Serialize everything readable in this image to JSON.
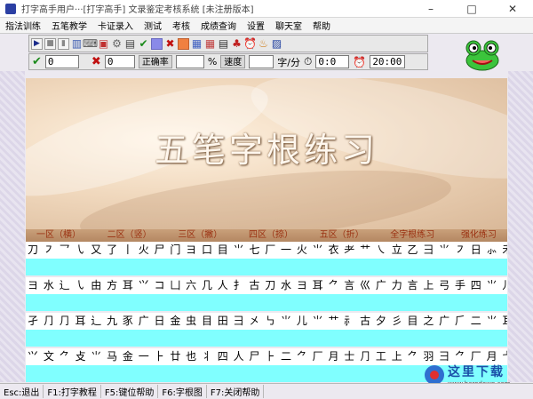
{
  "window": {
    "title": "打字高手用户···[打字高手]      文录鉴定考核系统  [未注册版本]",
    "minimize_glyph": "–",
    "maximize_glyph": "□",
    "close_glyph": "✕"
  },
  "menu": [
    "指法训练",
    "五笔教学",
    "卡证录入",
    "测试",
    "考核",
    "成绩查询",
    "设置",
    "聊天室",
    "帮助"
  ],
  "stats": {
    "correct_icon": "✔",
    "correct_value": "0",
    "wrong_icon": "✖",
    "wrong_value": "0",
    "accuracy_label": "正确率",
    "accuracy_value": "",
    "percent_unit": "%",
    "speed_label": "速度",
    "speed_value": "",
    "speed_unit": "字/分",
    "elapsed": "0:0",
    "limit": "20:00"
  },
  "banner": {
    "title": "五笔字根练习"
  },
  "tabs": [
    "一区（横）",
    "二区（竖）",
    "三区（撇）",
    "四区（捺）",
    "五区（折）",
    "全字根练习",
    "强化练习"
  ],
  "roots": [
    "刀 ㇇ 乛 ㇂ 又 了 丨 火 尸 门 ヨ 口 目 ⺌ 七 厂 一 火 ⺌ 衣 ⺹ 艹 ㇏ 立 乙 ⺕ ⺌ ㇇ 日 ⺗ 禾 口 一 角",
    "ヨ 水 辶 ㇂ 由 方 耳 ⺍ コ 凵 六 几 人 ⺘ 古 刀 水 ヨ 耳 ⺈ 言 巛 广 力 言 上 弓 手 四 ⺌ 儿 ⺌ 孑 几",
    "孑 ⺆ ⺆ 耳 辶 九 豕 广 日 金 虫 目 田 ⺕ 㐅 ㇉ ⺌ 儿 ⺌ 艹 ⺬ 古 夕 彡 目 之 广 ⺁ 二 ⺌ 耳 羽",
    "⺍ 文 ⺈ 攴 ⺌ 马 金 一 ⺊ 廿 也 丬 四 人 尸 ⺊ 二 ⺈ 厂 月 士 ⺆ 工 上 ⺈ 羽 ⺕ ⺈ 厂 月 弋 竹"
  ],
  "status": [
    "Esc:退出",
    "F1:打字教程",
    "F5:键位帮助",
    "F6:字根图",
    "F7:关闭帮助"
  ],
  "watermark": {
    "main": "这里下载",
    "sub": "www.herodown.com"
  },
  "toolbar_icons": [
    "play",
    "stop",
    "pause",
    "book",
    "keyboard",
    "blocks",
    "settings",
    "doc",
    "check",
    "purple-square",
    "x",
    "orange-square",
    "chart",
    "chart2",
    "note",
    "tree",
    "clock-red",
    "bell",
    "chart3"
  ],
  "colors": {
    "input_line": "#80ffff",
    "tab_text": "#9a3010",
    "banner_text": "#fff7ee"
  }
}
